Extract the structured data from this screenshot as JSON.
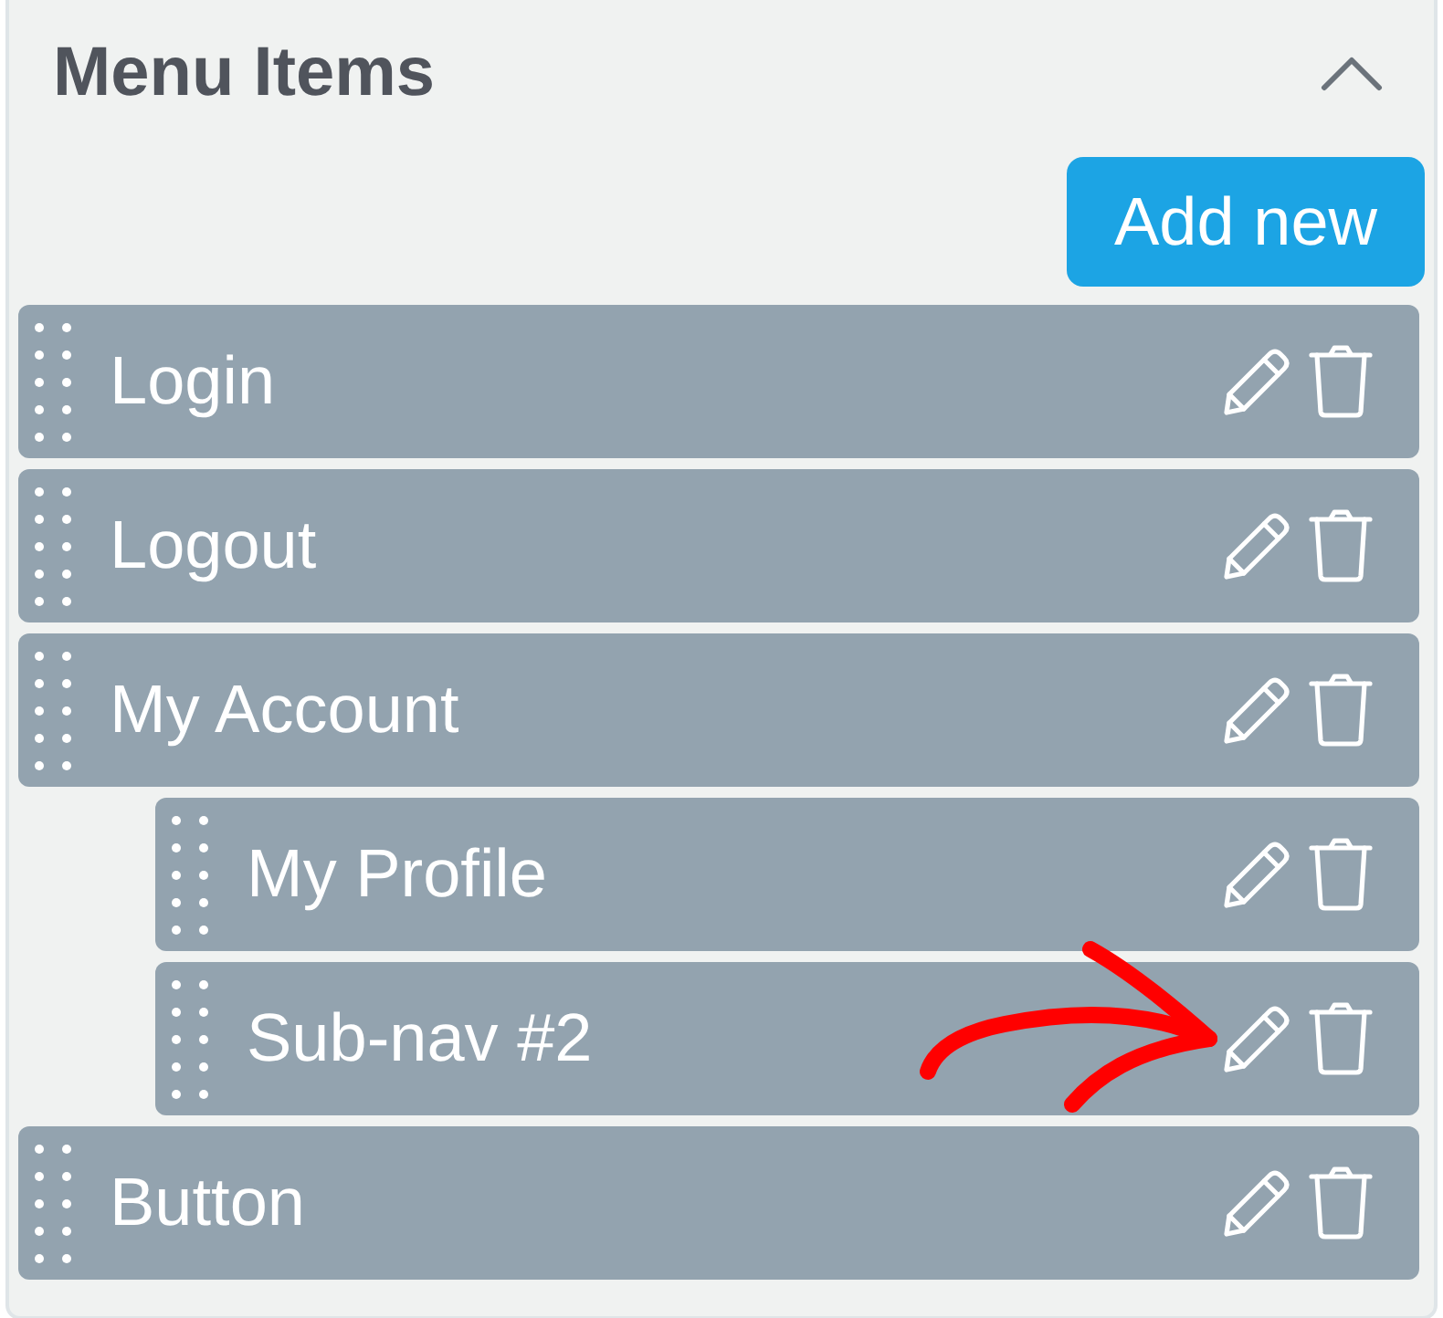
{
  "panel": {
    "title": "Menu Items",
    "expanded": true
  },
  "add_button": {
    "label": "Add new"
  },
  "menu_items": [
    {
      "label": "Login"
    },
    {
      "label": "Logout"
    },
    {
      "label": "My Account",
      "children": [
        {
          "label": "My Profile"
        },
        {
          "label": "Sub-nav #2"
        }
      ]
    },
    {
      "label": "Button"
    }
  ],
  "annotation": {
    "kind": "arrow"
  }
}
